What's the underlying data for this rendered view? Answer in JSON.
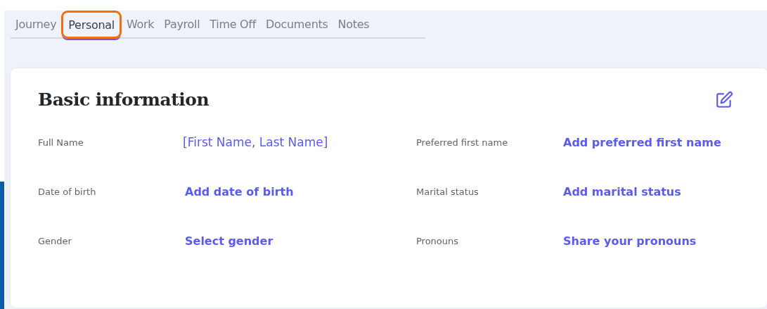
{
  "tabs": [
    {
      "label": "Journey",
      "selected": false
    },
    {
      "label": "Personal",
      "selected": true
    },
    {
      "label": "Work",
      "selected": false
    },
    {
      "label": "Payroll",
      "selected": false
    },
    {
      "label": "Time Off",
      "selected": false
    },
    {
      "label": "Documents",
      "selected": false
    },
    {
      "label": "Notes",
      "selected": false
    }
  ],
  "card": {
    "title": "Basic information",
    "fields": [
      {
        "label": "Full Name",
        "value": "[First Name, Last Name]",
        "kind": "text"
      },
      {
        "label": "Preferred first name",
        "value": "Add preferred first name",
        "kind": "link"
      },
      {
        "label": "Date of birth",
        "value": "Add date of birth",
        "kind": "link"
      },
      {
        "label": "Marital status",
        "value": "Add marital status",
        "kind": "link"
      },
      {
        "label": "Gender",
        "value": "Select gender",
        "kind": "link"
      },
      {
        "label": "Pronouns",
        "value": "Share your pronouns",
        "kind": "link"
      }
    ]
  }
}
